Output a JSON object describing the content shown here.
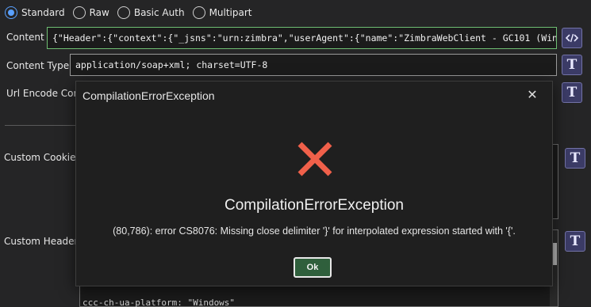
{
  "content_type_modes": {
    "options": [
      "Standard",
      "Raw",
      "Basic Auth",
      "Multipart"
    ],
    "selected": "Standard"
  },
  "content": {
    "label": "Content",
    "value": "{\"Header\":{\"context\":{\"_jsns\":\"urn:zimbra\",\"userAgent\":{\"name\":\"ZimbraWebClient - GC101 (Win)\",\"",
    "code_button_icon": "code-icon"
  },
  "content_type": {
    "label": "Content Type",
    "value": "application/soap+xml; charset=UTF-8",
    "button_glyph": "T"
  },
  "url_encode": {
    "label": "Url Encode Cont",
    "button_glyph": "T"
  },
  "custom_cookies": {
    "label": "Custom Cookies",
    "button_glyph": "T"
  },
  "custom_headers": {
    "label": "Custom Headers",
    "button_glyph": "T",
    "peek_text": "ccc-ch-ua-platform: \"Windows\""
  },
  "dialog": {
    "title": "CompilationErrorException",
    "heading": "CompilationErrorException",
    "message": "(80,786): error CS8076: Missing close delimiter '}' for interpolated expression started with '{'.",
    "ok_label": "Ok",
    "close_glyph": "✕"
  },
  "colors": {
    "accent_blue": "#5aa1ff",
    "error_red": "#f0604a",
    "ok_green": "#2f5f3c",
    "field_active_border": "#6fbf73",
    "t_button_bg": "#3b3b66"
  }
}
